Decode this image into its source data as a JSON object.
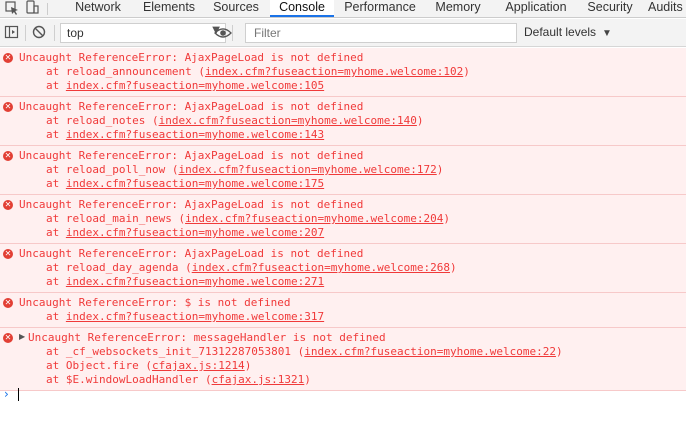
{
  "tabs": [
    {
      "label": "Network"
    },
    {
      "label": "Elements"
    },
    {
      "label": "Sources"
    },
    {
      "label": "Console",
      "active": true
    },
    {
      "label": "Performance"
    },
    {
      "label": "Memory"
    },
    {
      "label": "Application"
    },
    {
      "label": "Security"
    },
    {
      "label": "Audits"
    }
  ],
  "toolbar": {
    "context": "top",
    "filter_placeholder": "Filter",
    "levels": "Default levels"
  },
  "colors": {
    "error_text": "#f03a3a",
    "error_bg": "#fff0f0",
    "active_tab": "#1a73e8"
  },
  "messages": [
    {
      "text": "Uncaught ReferenceError: AjaxPageLoad is not defined",
      "frames": [
        {
          "prefix": "at reload_announcement (",
          "link": "index.cfm?fuseaction=myhome.welcome:102",
          "suffix": ")"
        },
        {
          "prefix": "at ",
          "link": "index.cfm?fuseaction=myhome.welcome:105",
          "suffix": ""
        }
      ]
    },
    {
      "text": "Uncaught ReferenceError: AjaxPageLoad is not defined",
      "frames": [
        {
          "prefix": "at reload_notes (",
          "link": "index.cfm?fuseaction=myhome.welcome:140",
          "suffix": ")"
        },
        {
          "prefix": "at ",
          "link": "index.cfm?fuseaction=myhome.welcome:143",
          "suffix": ""
        }
      ]
    },
    {
      "text": "Uncaught ReferenceError: AjaxPageLoad is not defined",
      "frames": [
        {
          "prefix": "at reload_poll_now (",
          "link": "index.cfm?fuseaction=myhome.welcome:172",
          "suffix": ")"
        },
        {
          "prefix": "at ",
          "link": "index.cfm?fuseaction=myhome.welcome:175",
          "suffix": ""
        }
      ]
    },
    {
      "text": "Uncaught ReferenceError: AjaxPageLoad is not defined",
      "frames": [
        {
          "prefix": "at reload_main_news (",
          "link": "index.cfm?fuseaction=myhome.welcome:204",
          "suffix": ")"
        },
        {
          "prefix": "at ",
          "link": "index.cfm?fuseaction=myhome.welcome:207",
          "suffix": ""
        }
      ]
    },
    {
      "text": "Uncaught ReferenceError: AjaxPageLoad is not defined",
      "frames": [
        {
          "prefix": "at reload_day_agenda (",
          "link": "index.cfm?fuseaction=myhome.welcome:268",
          "suffix": ")"
        },
        {
          "prefix": "at ",
          "link": "index.cfm?fuseaction=myhome.welcome:271",
          "suffix": ""
        }
      ]
    },
    {
      "text": "Uncaught ReferenceError: $ is not defined",
      "frames": [
        {
          "prefix": "at ",
          "link": "index.cfm?fuseaction=myhome.welcome:317",
          "suffix": ""
        }
      ]
    },
    {
      "expandable": true,
      "text": "Uncaught ReferenceError: messageHandler is not defined",
      "frames": [
        {
          "prefix": "at _cf_websockets_init_71312287053801 (",
          "link": "index.cfm?fuseaction=myhome.welcome:22",
          "suffix": ")"
        },
        {
          "prefix": "at Object.fire (",
          "link": "cfajax.js:1214",
          "suffix": ")"
        },
        {
          "prefix": "at $E.windowLoadHandler (",
          "link": "cfajax.js:1321",
          "suffix": ")"
        }
      ]
    }
  ],
  "prompt_symbol": "›"
}
